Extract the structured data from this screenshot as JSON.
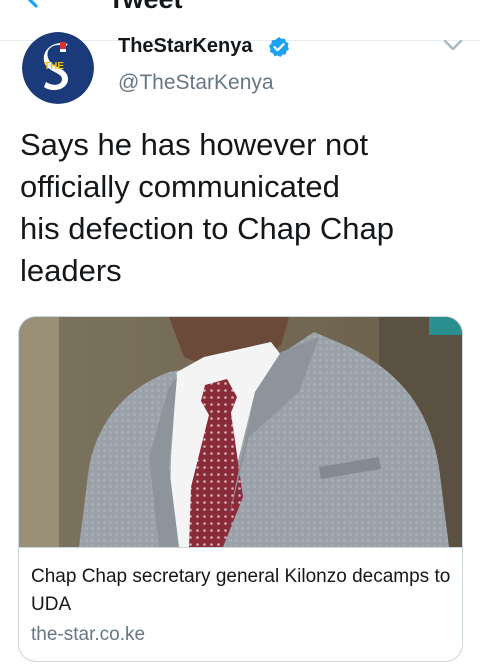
{
  "header": {
    "title": "Tweet",
    "back_icon": "back-arrow-icon",
    "accent_color": "#1da1f2"
  },
  "author": {
    "name": "TheStarKenya",
    "handle": "@TheStarKenya",
    "verified_icon": "verified-badge-icon",
    "avatar_text": "THE",
    "avatar_icon": "the-star-logo",
    "avatar_color": "#1a3a7a"
  },
  "tweet": {
    "lines": [
      "Says he has however not",
      "officially communicated",
      "his defection to Chap Chap",
      "leaders"
    ]
  },
  "card": {
    "title": "Chap Chap secretary general Kilonzo decamps to UDA",
    "domain": "the-star.co.ke"
  },
  "menu": {
    "more_icon": "chevron-down-icon"
  }
}
